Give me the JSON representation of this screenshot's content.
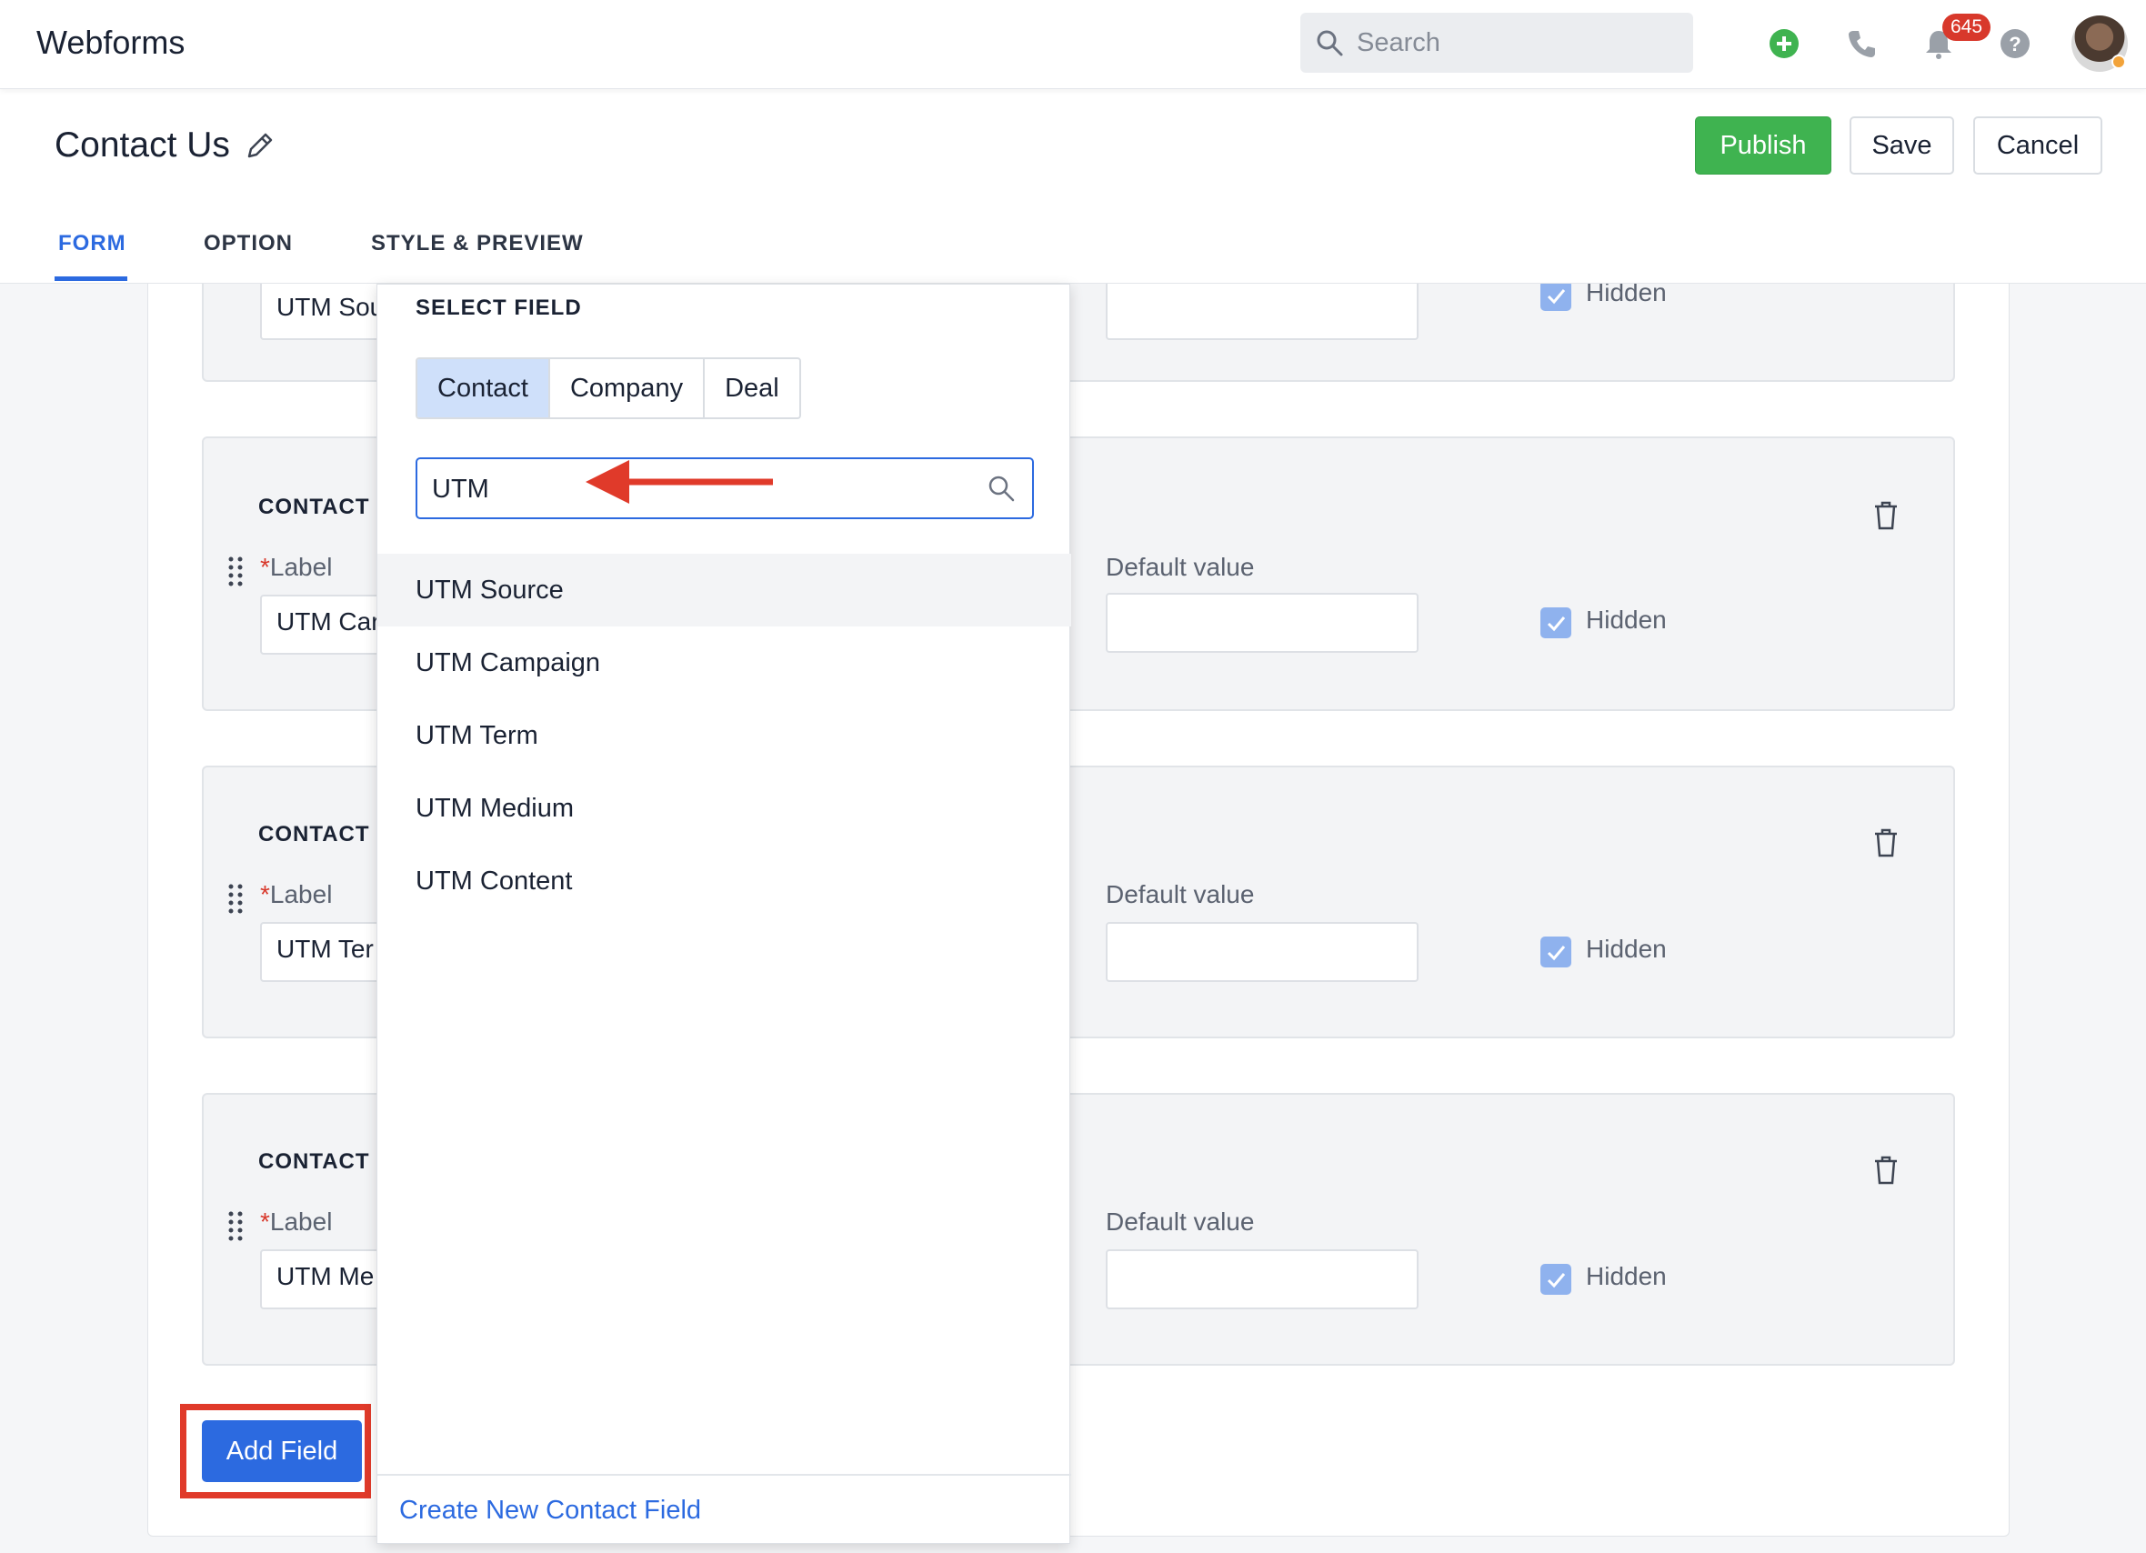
{
  "app": {
    "title": "Webforms"
  },
  "search": {
    "placeholder": "Search"
  },
  "notifications": {
    "count": "645"
  },
  "page": {
    "title": "Contact Us"
  },
  "actions": {
    "publish": "Publish",
    "save": "Save",
    "cancel": "Cancel"
  },
  "tabs": [
    {
      "label": "FORM",
      "active": true
    },
    {
      "label": "OPTION",
      "active": false
    },
    {
      "label": "STYLE & PREVIEW",
      "active": false
    }
  ],
  "cards": [
    {
      "title": "",
      "label_value": "UTM Sou",
      "hidden_label": "Hidden",
      "hidden": true
    },
    {
      "title": "CONTACT :",
      "label_caption": "Label",
      "label_value": "UTM Car",
      "default_caption": "Default value",
      "hidden_label": "Hidden",
      "hidden": true
    },
    {
      "title": "CONTACT :",
      "label_caption": "Label",
      "label_value": "UTM Ter",
      "default_caption": "Default value",
      "hidden_label": "Hidden",
      "hidden": true
    },
    {
      "title": "CONTACT :",
      "label_caption": "Label",
      "label_value": "UTM Me",
      "default_caption": "Default value",
      "hidden_label": "Hidden",
      "hidden": true
    }
  ],
  "add_field": {
    "label": "Add Field"
  },
  "select_field": {
    "heading": "SELECT FIELD",
    "segments": [
      {
        "label": "Contact",
        "active": true
      },
      {
        "label": "Company",
        "active": false
      },
      {
        "label": "Deal",
        "active": false
      }
    ],
    "search_value": "UTM",
    "options": [
      "UTM Source",
      "UTM Campaign",
      "UTM Term",
      "UTM Medium",
      "UTM Content"
    ],
    "footer_link": "Create New Contact Field"
  },
  "colors": {
    "accent": "#2c6ae0",
    "publish": "#3fb350",
    "highlight": "#e03a2a",
    "checkbox": "#8fb2ee"
  }
}
